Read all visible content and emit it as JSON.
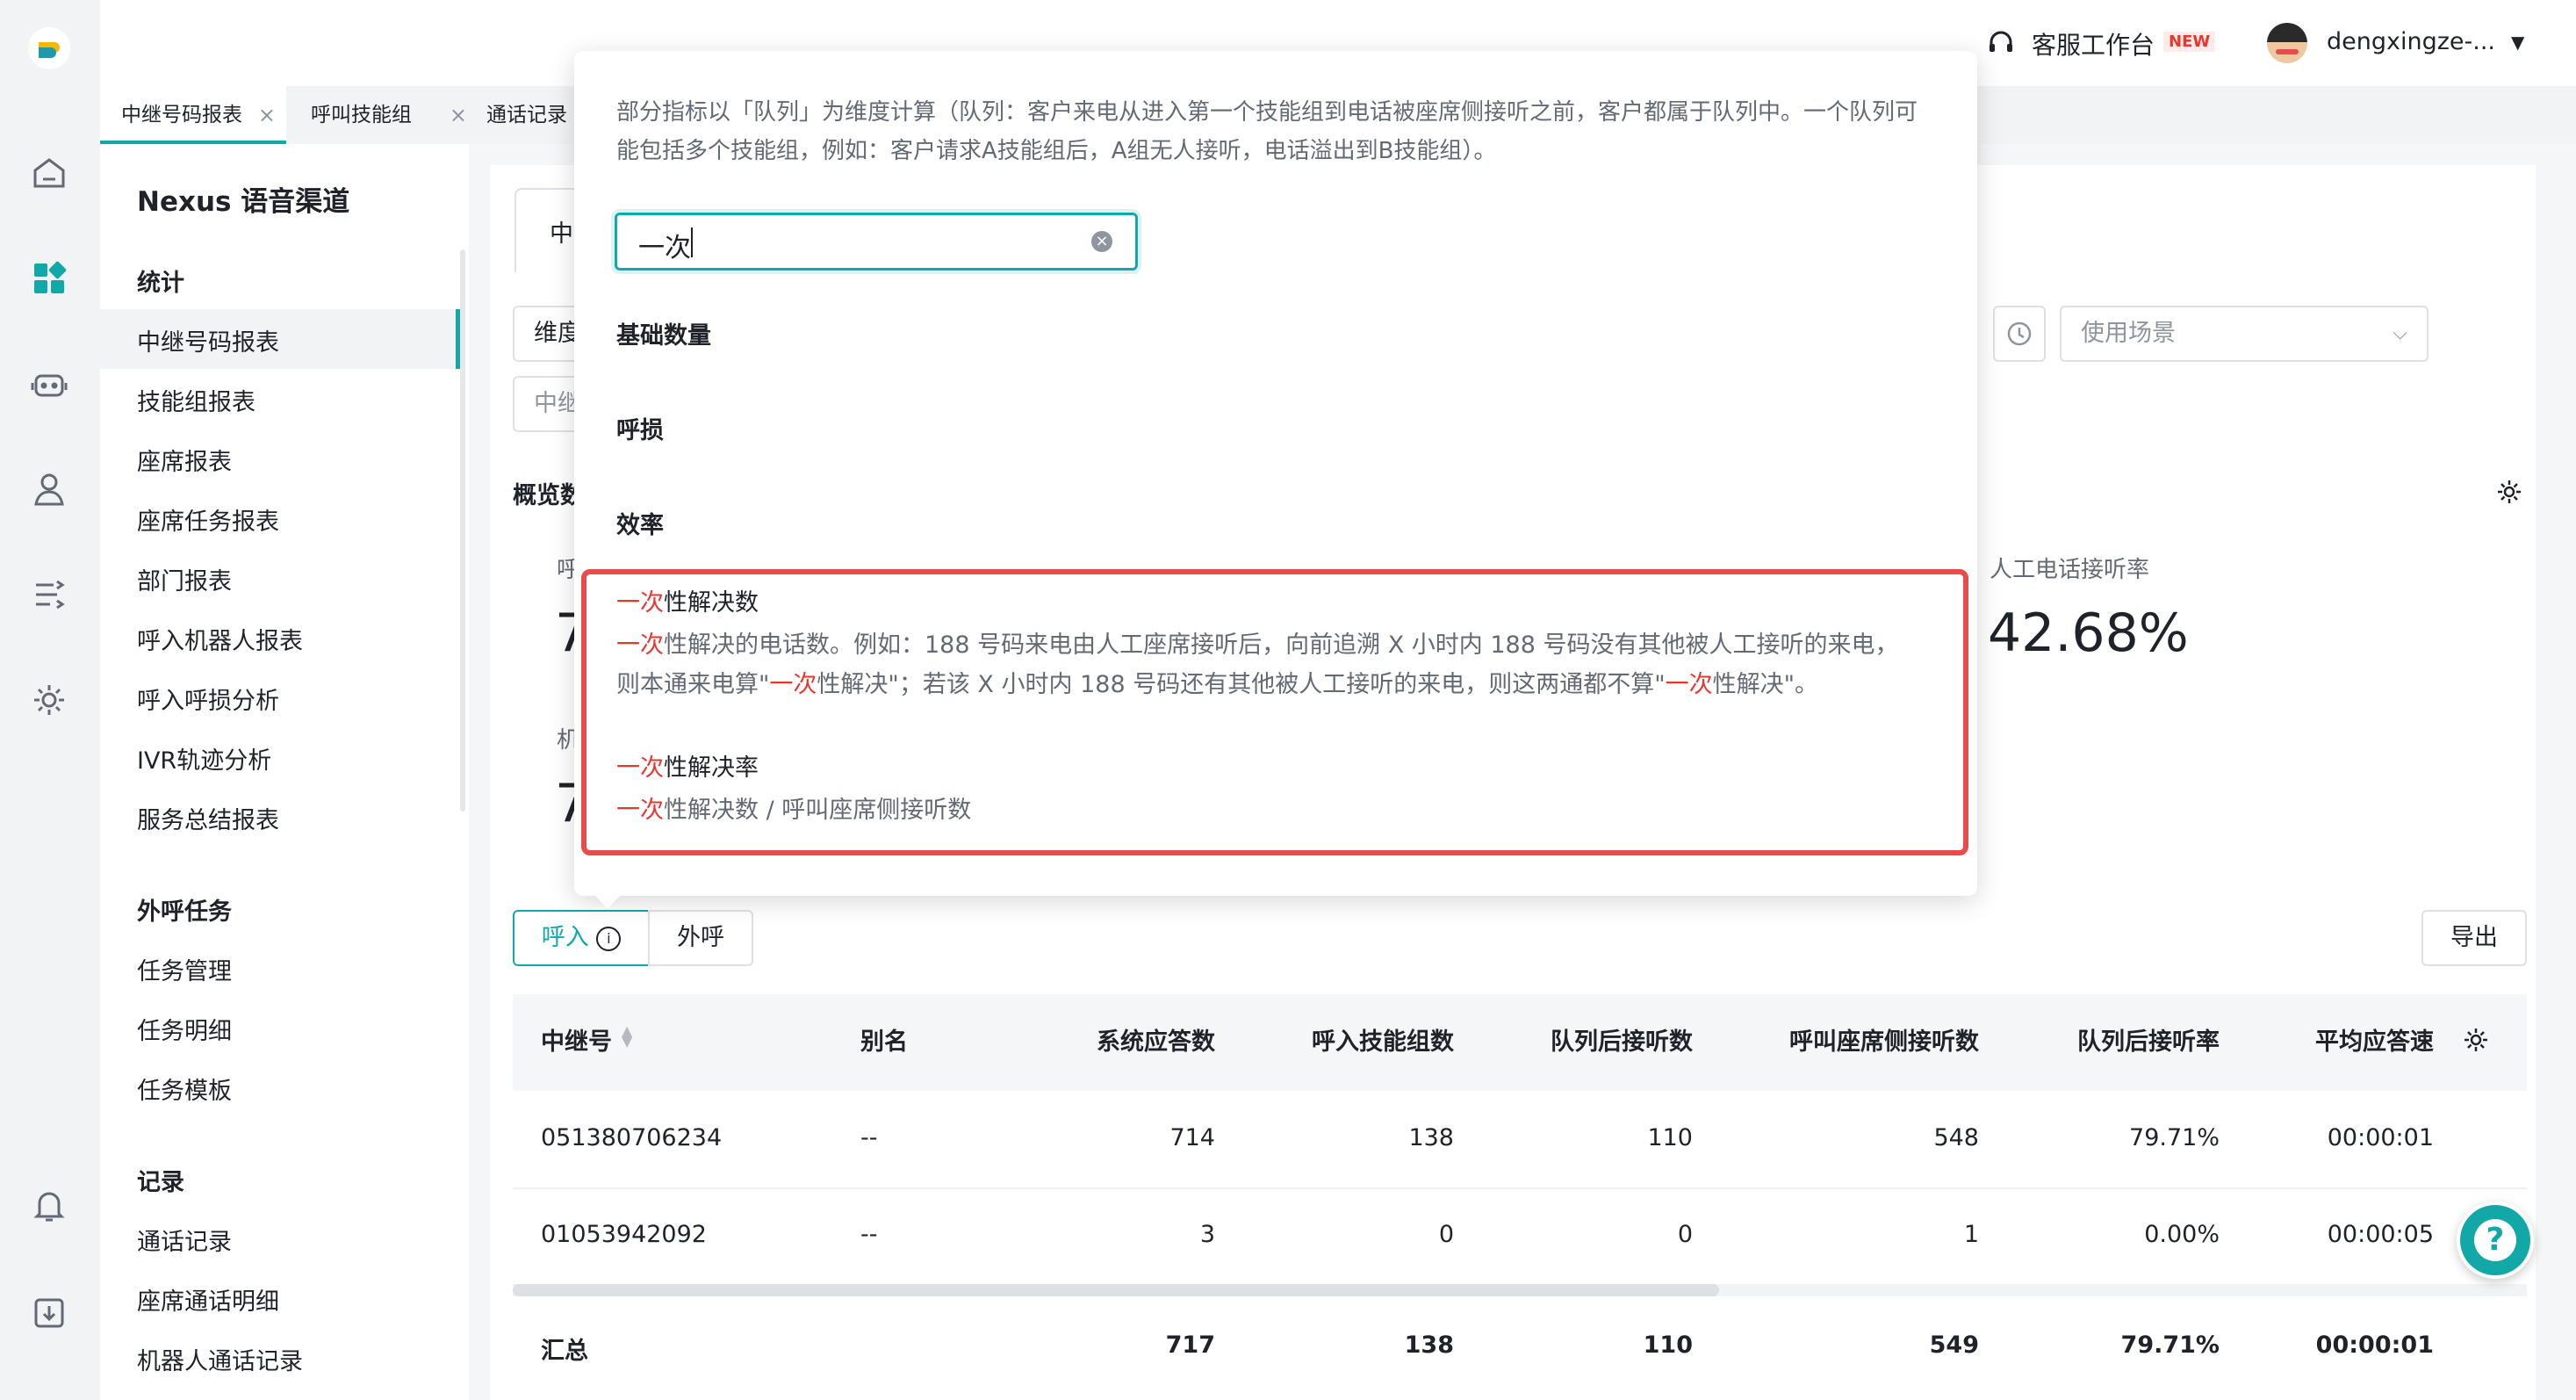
{
  "topbar": {
    "workspace": "客服工作台",
    "workspace_badge": "NEW",
    "username": "dengxingze-..."
  },
  "tabs": [
    {
      "label": "中继号码报表"
    },
    {
      "label": "呼叫技能组"
    },
    {
      "label": "通话记录"
    }
  ],
  "sidebar": {
    "title": "Nexus 语音渠道",
    "sections": [
      {
        "heading": "统计",
        "items": [
          "中继号码报表",
          "技能组报表",
          "座席报表",
          "座席任务报表",
          "部门报表",
          "呼入机器人报表",
          "呼入呼损分析",
          "IVR轨迹分析",
          "服务总结报表"
        ]
      },
      {
        "heading": "外呼任务",
        "items": [
          "任务管理",
          "任务明细",
          "任务模板"
        ]
      },
      {
        "heading": "记录",
        "items": [
          "通话记录",
          "座席通话明细",
          "机器人通话记录"
        ]
      }
    ]
  },
  "main": {
    "partial_tab": "中",
    "filter_dimension": "维度",
    "filter_relay": "中继",
    "usage_placeholder": "使用场景",
    "overview_label": "概览数",
    "metric_label_a": "呼",
    "metric_value_a": "7",
    "metric_label_b": "机",
    "metric_value_b": "7",
    "manual_rate_label": "人工电话接听率",
    "manual_rate_value": "42.68%",
    "toggle_in": "呼入",
    "toggle_out": "外呼",
    "export": "导出"
  },
  "table": {
    "headers": [
      "中继号",
      "别名",
      "系统应答数",
      "呼入技能组数",
      "队列后接听数",
      "呼叫座席侧接听数",
      "队列后接听率",
      "平均应答速"
    ],
    "rows": [
      [
        "051380706234",
        "--",
        "714",
        "138",
        "110",
        "548",
        "79.71%",
        "00:00:01"
      ],
      [
        "01053942092",
        "--",
        "3",
        "0",
        "0",
        "1",
        "0.00%",
        "00:00:05"
      ]
    ],
    "total": [
      "汇总",
      "",
      "717",
      "138",
      "110",
      "549",
      "79.71%",
      "00:00:01"
    ]
  },
  "popover": {
    "description": "部分指标以「队列」为维度计算（队列：客户来电从进入第一个技能组到电话被座席侧接听之前，客户都属于队列中。一个队列可能包括多个技能组，例如：客户请求A技能组后，A组无人接听，电话溢出到B技能组）。",
    "search_value": "一次",
    "groups": [
      "基础数量",
      "呼损",
      "效率"
    ],
    "metrics": [
      {
        "title_hl": "一次",
        "title_rest": "性解决数",
        "desc_parts": [
          {
            "t": "一次",
            "hl": true
          },
          {
            "t": "性解决的电话数。例如：188 号码来电由人工座席接听后，向前追溯 X 小时内 188 号码没有其他被人工接听的来电，则本通来电算\"",
            "hl": false
          },
          {
            "t": "一次",
            "hl": true
          },
          {
            "t": "性解决\"；若该 X 小时内 188 号码还有其他被人工接听的来电，则这两通都不算\"",
            "hl": false
          },
          {
            "t": "一次",
            "hl": true
          },
          {
            "t": "性解决\"。",
            "hl": false
          }
        ]
      },
      {
        "title_hl": "一次",
        "title_rest": "性解决率",
        "desc_parts": [
          {
            "t": "一次",
            "hl": true
          },
          {
            "t": "性解决数 / 呼叫座席侧接听数",
            "hl": false
          }
        ]
      }
    ]
  },
  "colors": {
    "accent": "#13a8a8",
    "highlight": "#e8372f",
    "box": "#e84b4b"
  }
}
